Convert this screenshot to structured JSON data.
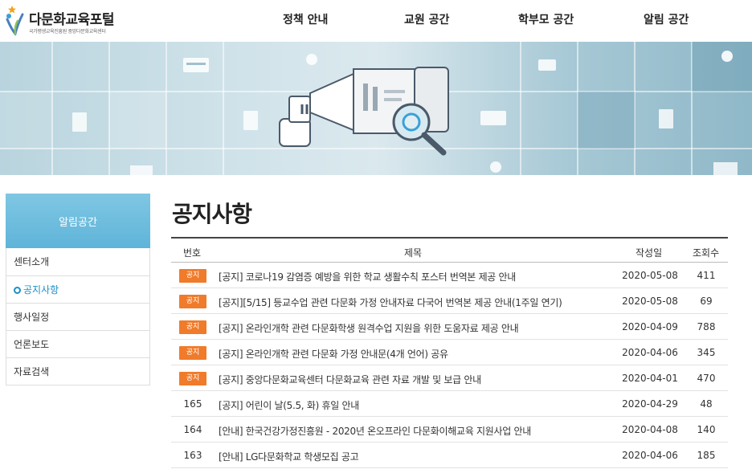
{
  "logo": {
    "title": "다문화교육포털",
    "subtitle": "국가평생교육진흥원 중앙다문화교육센터"
  },
  "gnb": [
    "정책 안내",
    "교원 공간",
    "학부모 공간",
    "알림 공간"
  ],
  "sidebar": {
    "title": "알림공간",
    "items": [
      {
        "label": "센터소개",
        "active": false
      },
      {
        "label": "공지사항",
        "active": true
      },
      {
        "label": "행사일정",
        "active": false
      },
      {
        "label": "언론보도",
        "active": false
      },
      {
        "label": "자료검색",
        "active": false
      }
    ]
  },
  "page_title": "공지사항",
  "board": {
    "headers": {
      "num": "번호",
      "subject": "제목",
      "date": "작성일",
      "views": "조회수"
    },
    "notice_badge": "공지",
    "rows": [
      {
        "num": "",
        "notice": true,
        "subject": "[공지] 코로나19 감염증 예방을 위한 학교 생활수칙 포스터 번역본 제공 안내",
        "date": "2020-05-08",
        "views": "411"
      },
      {
        "num": "",
        "notice": true,
        "subject": "[공지][5/15] 등교수업 관련 다문화 가정 안내자료 다국어 번역본 제공 안내(1주일 연기)",
        "date": "2020-05-08",
        "views": "69"
      },
      {
        "num": "",
        "notice": true,
        "subject": "[공지] 온라인개학 관련 다문화학생 원격수업 지원을 위한 도움자료 제공 안내",
        "date": "2020-04-09",
        "views": "788"
      },
      {
        "num": "",
        "notice": true,
        "subject": "[공지] 온라인개학 관련 다문화 가정 안내문(4개 언어) 공유",
        "date": "2020-04-06",
        "views": "345"
      },
      {
        "num": "",
        "notice": true,
        "subject": "[공지] 중앙다문화교육센터 다문화교육 관련 자료 개발 및 보급 안내",
        "date": "2020-04-01",
        "views": "470"
      },
      {
        "num": "165",
        "notice": false,
        "subject": "[공지] 어린이 날(5.5, 화) 휴일 안내",
        "date": "2020-04-29",
        "views": "48"
      },
      {
        "num": "164",
        "notice": false,
        "subject": "[안내] 한국건강가정진흥원 - 2020년 온오프라인 다문화이해교육 지원사업 안내",
        "date": "2020-04-08",
        "views": "140"
      },
      {
        "num": "163",
        "notice": false,
        "subject": "[안내] LG다문화학교 학생모집 공고",
        "date": "2020-04-06",
        "views": "185"
      }
    ]
  }
}
